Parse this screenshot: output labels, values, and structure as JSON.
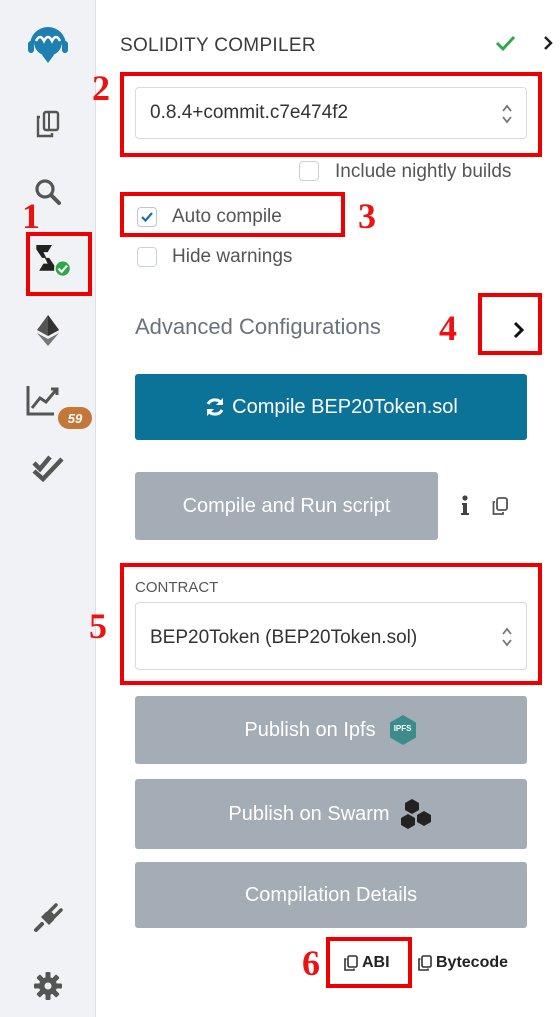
{
  "rail": {
    "badge_count": "59",
    "icons": [
      "remix-logo-icon",
      "file-explorer-icon",
      "search-icon",
      "solidity-compiler-icon",
      "deploy-run-icon",
      "analysis-icon",
      "unit-testing-icon",
      "plugin-manager-icon",
      "settings-icon"
    ]
  },
  "panel": {
    "title": "SOLIDITY COMPILER",
    "compiler_version": "0.8.4+commit.c7e474f2",
    "include_nightly_label": "Include nightly builds",
    "auto_compile_label": "Auto compile",
    "hide_warnings_label": "Hide warnings",
    "advanced_label": "Advanced Configurations",
    "compile_button": "Compile BEP20Token.sol",
    "compile_run_button": "Compile and Run script",
    "contract_label": "CONTRACT",
    "contract_value": "BEP20Token (BEP20Token.sol)",
    "publish_ipfs": "Publish on Ipfs",
    "ipfs_badge": "IPFS",
    "publish_swarm": "Publish on Swarm",
    "details_button": "Compilation Details",
    "abi_label": "ABI",
    "bytecode_label": "Bytecode"
  },
  "state": {
    "auto_compile": true,
    "include_nightly": false,
    "hide_warnings": false
  },
  "annotations": [
    "1",
    "2",
    "3",
    "4",
    "5",
    "6"
  ],
  "colors": {
    "primary": "#0b7398",
    "secondary": "#a4adb6",
    "success": "#2ea84a",
    "annotation": "#ee0000"
  }
}
